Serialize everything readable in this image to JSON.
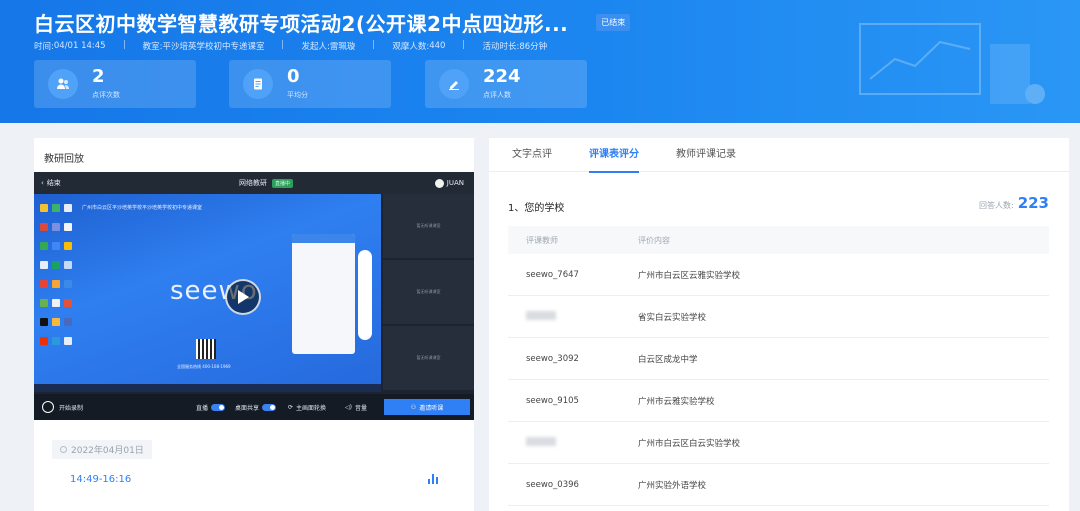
{
  "header": {
    "title": "白云区初中数学智慧教研专项活动2(公开课2中点四边形...",
    "status_badge": "已结束",
    "meta": [
      {
        "label": "时间: ",
        "value": "04/01 14:45"
      },
      {
        "label": "教室: ",
        "value": "平沙培英学校初中专递课室"
      },
      {
        "label": "发起人: ",
        "value": "雷珮璇"
      },
      {
        "label": "观摩人数: ",
        "value": "440"
      },
      {
        "label": "活动时长: ",
        "value": "86分钟"
      }
    ],
    "stats": [
      {
        "value": "2",
        "label": "点评次数",
        "icon": "users-icon"
      },
      {
        "value": "0",
        "label": "平均分",
        "icon": "document-icon"
      },
      {
        "value": "224",
        "label": "点评人数",
        "icon": "edit-icon"
      }
    ]
  },
  "left": {
    "title": "教研回放",
    "player": {
      "back_label": "结束",
      "center_title": "网络教研",
      "live_tag": "直播中",
      "user_name": "JUAN",
      "screen_heading": "广州市白云区平沙培英学校平沙培英学校初中专递课室",
      "brand": "seewo",
      "qr_caption": "全国服务热线 400-108-1969",
      "side_tiles": [
        "暂无听课课室",
        "暂无听课课室",
        "暂无听课课室"
      ],
      "controls": {
        "record": "开始录制",
        "live": "直播",
        "desktop_share": "桌面共享",
        "main_switch": "主画面轮换",
        "volume": "音量",
        "invite": "邀请听课"
      }
    },
    "session": {
      "date": "2022年04月01日",
      "time_range": "14:49-16:16"
    }
  },
  "right": {
    "tabs": [
      "文字点评",
      "评课表评分",
      "教师评课记录"
    ],
    "active_tab": 1,
    "question": "1、您的学校",
    "answer_label": "回答人数:",
    "answer_count": "223",
    "columns": [
      "评课教师",
      "评价内容"
    ],
    "rows": [
      {
        "teacher": "seewo_7647",
        "content": "广州市白云区云雅实验学校"
      },
      {
        "teacher": "",
        "content": "省实白云实验学校"
      },
      {
        "teacher": "seewo_3092",
        "content": "白云区成龙中学"
      },
      {
        "teacher": "seewo_9105",
        "content": "广州市云雅实验学校"
      },
      {
        "teacher": "",
        "content": "广州市白云区白云实验学校"
      },
      {
        "teacher": "seewo_0396",
        "content": "广州实验外语学校"
      }
    ]
  },
  "colors": {
    "accent": "#2f7ff5",
    "banner": "#1677e8"
  }
}
